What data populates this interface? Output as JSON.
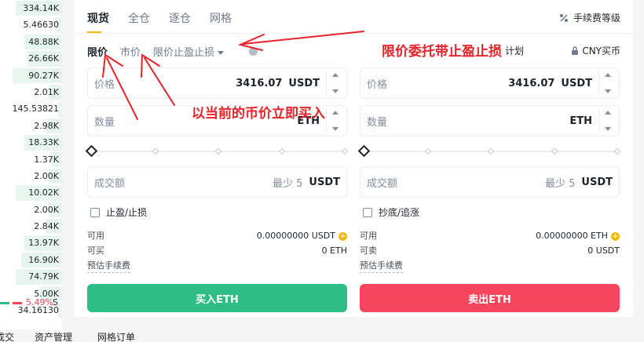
{
  "orderbook": {
    "volumes": [
      "334.14K",
      "5.46630",
      "48.88K",
      "26.66K",
      "90.27K",
      "2.01K",
      "145.53821",
      "2.98K",
      "18.33K",
      "1.37K",
      "2.00K",
      "10.02K",
      "2.00K",
      "2.84K",
      "13.97K",
      "16.90K",
      "74.79K",
      "5.00K",
      "34.16130"
    ],
    "change_pct": "5.49%",
    "s_label": "S"
  },
  "tabs": [
    "现货",
    "全仓",
    "逐仓",
    "网格"
  ],
  "fee_label": "手续费等级",
  "order_types": [
    "限价",
    "市价",
    "限价止盈止损"
  ],
  "plan_label": "计划",
  "cny_label": "CNY买币",
  "buy": {
    "price_label": "价格",
    "price_value": "3416.07",
    "price_unit": "USDT",
    "qty_label": "数量",
    "qty_unit": "ETH",
    "amount_label": "成交额",
    "amount_min": "最少 5",
    "amount_unit": "USDT",
    "checkbox_label": "止盈/止损",
    "avail_label": "可用",
    "avail_value": "0.00000000 USDT",
    "can_label": "可买",
    "can_value": "0 ETH",
    "fee_label": "预估手续费",
    "button": "买入ETH"
  },
  "sell": {
    "price_label": "价格",
    "price_value": "3416.07",
    "price_unit": "USDT",
    "qty_label": "数量",
    "qty_unit": "ETH",
    "amount_label": "成交额",
    "amount_min": "最少 5",
    "amount_unit": "USDT",
    "checkbox_label": "抄底/追涨",
    "avail_label": "可用",
    "avail_value": "0.00000000 ETH",
    "can_label": "可卖",
    "can_value": "0 USDT",
    "fee_label": "预估手续费",
    "button": "卖出ETH"
  },
  "bottom_nav": [
    "成交",
    "资产管理",
    "网格订单"
  ],
  "annotations": {
    "limit_tp_sl": "限价委托带止盈止损",
    "market": "以当前的币价立即买入"
  },
  "colors": {
    "buy": "#2ebd85",
    "sell": "#f6465d",
    "accent": "#f0b90b",
    "annotation": "#e8222a"
  }
}
